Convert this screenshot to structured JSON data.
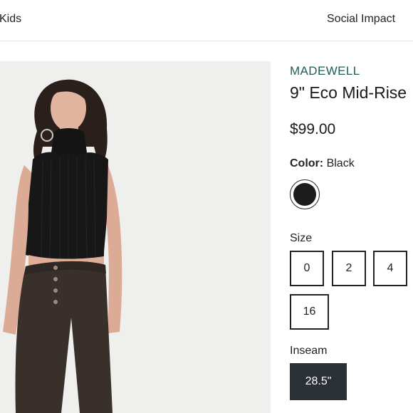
{
  "nav": {
    "kids": "Kids",
    "social_impact": "Social Impact"
  },
  "product": {
    "brand": "MADEWELL",
    "title": "9\" Eco Mid-Rise",
    "price": "$99.00",
    "color_label": "Color:",
    "color_value": "Black",
    "size_label": "Size",
    "sizes": [
      "0",
      "2",
      "4",
      "16"
    ],
    "inseam_label": "Inseam",
    "inseam_value": "28.5\""
  },
  "colors": {
    "brand": "#1f5d57",
    "swatch_black": "#1c1c1c",
    "inseam_selected": "#2b2f36"
  }
}
